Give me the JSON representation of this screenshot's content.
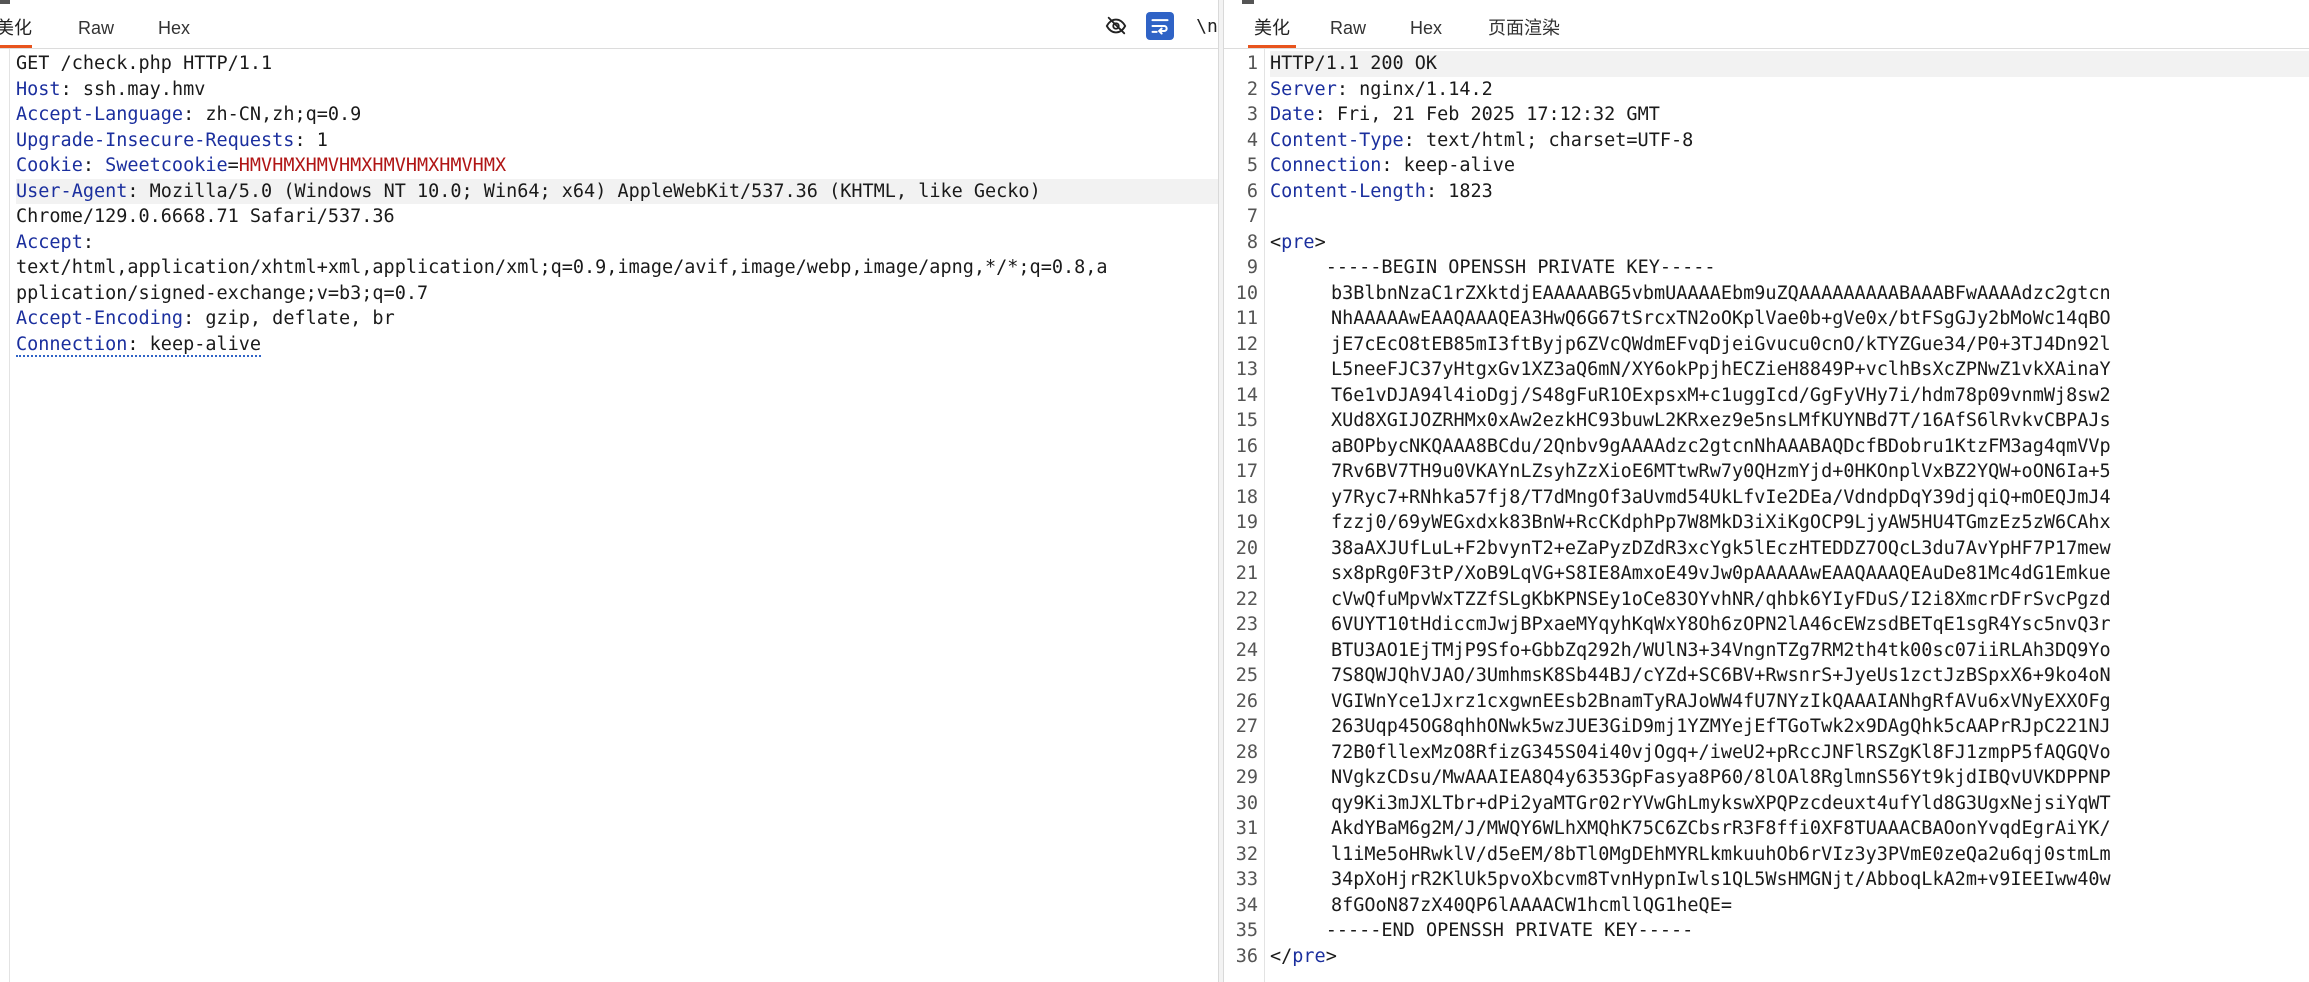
{
  "request": {
    "tabs": [
      "美化",
      "Raw",
      "Hex"
    ],
    "toolbar": [
      "eye-off-icon",
      "wrap-icon",
      "\\n",
      "menu-icon"
    ],
    "request_line": "GET /check.php HTTP/1.1",
    "headers": [
      {
        "name": "Host",
        "value": "ssh.may.hmv"
      },
      {
        "name": "Accept-Language",
        "value": "zh-CN,zh;q=0.9"
      },
      {
        "name": "Upgrade-Insecure-Requests",
        "value": "1"
      }
    ],
    "cookie": {
      "label": "Cookie",
      "name": "Sweetcookie",
      "value": "HMVHMXHMVHMXHMVHMXHMVHMX"
    },
    "user_agent": {
      "name": "User-Agent",
      "value_line1": "Mozilla/5.0 (Windows NT 10.0; Win64; x64) AppleWebKit/537.36 (KHTML, like Gecko)",
      "value_line2": "Chrome/129.0.6668.71 Safari/537.36"
    },
    "accept": {
      "name": "Accept",
      "value_line1": "text/html,application/xhtml+xml,application/xml;q=0.9,image/avif,image/webp,image/apng,*/*;q=0.8,a",
      "value_line2": "pplication/signed-exchange;v=b3;q=0.7"
    },
    "accept_encoding": {
      "name": "Accept-Encoding",
      "value": "gzip, deflate, br"
    },
    "connection": {
      "name": "Connection",
      "value": "keep-alive"
    }
  },
  "response": {
    "tabs": [
      "美化",
      "Raw",
      "Hex",
      "页面渲染"
    ],
    "status_line": "HTTP/1.1 200 OK",
    "headers": [
      {
        "name": "Server",
        "value": "nginx/1.14.2"
      },
      {
        "name": "Date",
        "value": "Fri, 21 Feb 2025 17:12:32 GMT"
      },
      {
        "name": "Content-Type",
        "value": "text/html; charset=UTF-8"
      },
      {
        "name": "Connection",
        "value": "keep-alive"
      },
      {
        "name": "Content-Length",
        "value": "1823"
      }
    ],
    "pre_open": "pre",
    "pre_close": "pre",
    "key_begin": "-----BEGIN OPENSSH PRIVATE KEY-----",
    "key_lines": [
      "b3BlbnNzaC1rZXktdjEAAAAABG5vbmUAAAAEbm9uZQAAAAAAAAABAAABFwAAAAdzc2gtcn",
      "NhAAAAAwEAAQAAAQEA3HwQ6G67tSrcxTN2oOKplVae0b+gVe0x/btFSgGJy2bMoWc14qBO",
      "jE7cEcO8tEB85mI3ftByjp6ZVcQWdmEFvqDjeiGvucu0cnO/kTYZGue34/P0+3TJ4Dn92l",
      "L5neeFJC37yHtgxGv1XZ3aQ6mN/XY6okPpjhECZieH8849P+vclhBsXcZPNwZ1vkXAinaY",
      "T6e1vDJA94l4ioDgj/S48gFuR1OExpsxM+c1uggIcd/GgFyVHy7i/hdm78p09vnmWj8sw2",
      "XUd8XGIJOZRHMx0xAw2ezkHC93buwL2KRxez9e5nsLMfKUYNBd7T/16AfS6lRvkvCBPAJs",
      "aBOPbycNKQAAA8BCdu/2Qnbv9gAAAAdzc2gtcnNhAAABAQDcfBDobru1KtzFM3ag4qmVVp",
      "7Rv6BV7TH9u0VKAYnLZsyhZzXioE6MTtwRw7y0QHzmYjd+0HKOnplVxBZ2YQW+oON6Ia+5",
      "y7Ryc7+RNhka57fj8/T7dMngOf3aUvmd54UkLfvIe2DEa/VdndpDqY39djqiQ+mOEQJmJ4",
      "fzzj0/69yWEGxdxk83BnW+RcCKdphPp7W8MkD3iXiKgOCP9LjyAW5HU4TGmzEz5zW6CAhx",
      "38aAXJUfLuL+F2bvynT2+eZaPyzDZdR3xcYgk5lEczHTEDDZ7OQcL3du7AvYpHF7P17mew",
      "sx8pRg0F3tP/XoB9LqVG+S8IE8AmxoE49vJw0pAAAAAwEAAQAAAQEAuDe81Mc4dG1Emkue",
      "cVwQfuMpvWxTZZfSLgKbKPNSEy1oCe83OYvhNR/qhbk6YIyFDuS/I2i8XmcrDFrSvcPgzd",
      "6VUYT10tHdiccmJwjBPxaeMYqyhKqWxY8Oh6zOPN2lA46cEWzsdBETqE1sgR4Ysc5nvQ3r",
      "BTU3AO1EjTMjP9Sfo+GbbZq292h/WUlN3+34VngnTZg7RM2th4tk00sc07iiRLAh3DQ9Yo",
      "7S8QWJQhVJAO/3UmhmsK8Sb44BJ/cYZd+SC6BV+RwsnrS+JyeUs1zctJzBSpxX6+9ko4oN",
      "VGIWnYce1Jxrz1cxgwnEEsb2BnamTyRAJoWW4fU7NYzIkQAAAIANhgRfAVu6xVNyEXXOFg",
      "263Uqp45OG8qhhONwk5wzJUE3GiD9mj1YZMYejEfTGoTwk2x9DAgQhk5cAAPrRJpC221NJ",
      "72B0fllexMzO8RfizG345S04i40vjOgq+/iweU2+pRccJNFlRSZgKl8FJ1zmpP5fAQGQVo",
      "NVgkzCDsu/MwAAAIEA8Q4y6353GpFasya8P60/8lOAl8RglmnS56Yt9kjdIBQvUVKDPPNP",
      "qy9Ki3mJXLTbr+dPi2yaMTGr02rYVwGhLmykswXPQPzcdeuxt4ufYld8G3UgxNejsiYqWT",
      "AkdYBaM6g2M/J/MWQY6WLhXMQhK75C6ZCbsrR3F8ffi0XF8TUAAACBAOonYvqdEgrAiYK/",
      "l1iMe5oHRwklV/d5eEM/8bTl0MgDEhMYRLkmkuuhOb6rVIz3y3PVmE0zeQa2u6qj0stmLm",
      "34pXoHjrR2KlUk5pvoXbcvm8TvnHypnIwls1QL5WsHMGNjt/AbboqLkA2m+v9IEEIww40w",
      "8fGOoN87zX40QP6lAAAACW1hcmllQG1heQE="
    ],
    "key_end": "-----END OPENSSH PRIVATE KEY-----",
    "line_numbers": [
      "1",
      "2",
      "3",
      "4",
      "5",
      "6",
      "7",
      "8",
      "9",
      "10",
      "11",
      "12",
      "13",
      "14",
      "15",
      "16",
      "17",
      "18",
      "19",
      "20",
      "21",
      "22",
      "23",
      "24",
      "25",
      "26",
      "27",
      "28",
      "29",
      "30",
      "31",
      "32",
      "33",
      "34",
      "35",
      "36"
    ]
  }
}
